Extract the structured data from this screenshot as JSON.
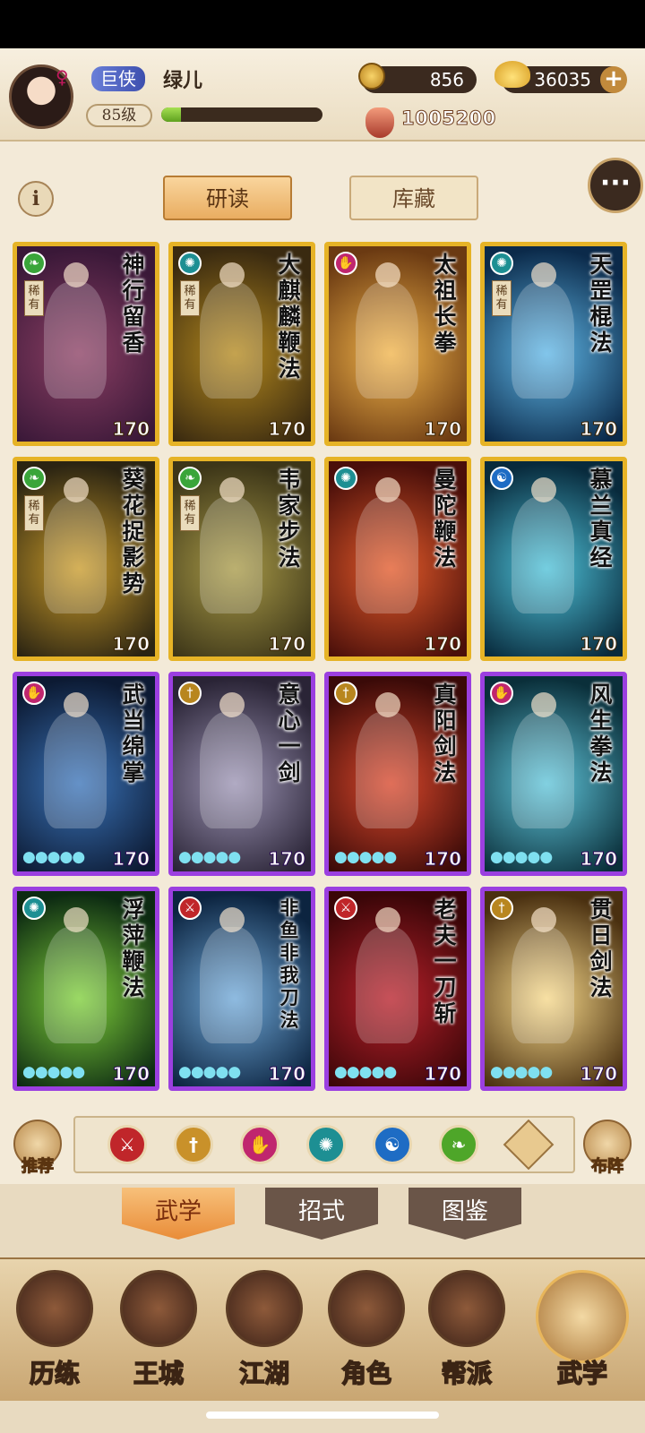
{
  "header": {
    "rank": "巨侠",
    "player_name": "绿儿",
    "level": "85级",
    "exp_fraction": 0.12,
    "coins": "856",
    "gold_ingots": "36035",
    "power": "1005200"
  },
  "tabs": {
    "study": "研读",
    "storage": "库藏"
  },
  "cards": [
    {
      "name": "神行留香",
      "value": "170",
      "rare_tag": "稀有",
      "frame": "gold",
      "sect": "green",
      "art": [
        "#3a1838",
        "#8b3f63"
      ]
    },
    {
      "name": "大麒麟鞭法",
      "value": "170",
      "rare_tag": "稀有",
      "frame": "gold",
      "sect": "teal",
      "art": [
        "#3a2a10",
        "#b4891e"
      ]
    },
    {
      "name": "太祖长拳",
      "value": "170",
      "rare_tag": "",
      "frame": "gold",
      "sect": "magenta",
      "art": [
        "#6b3a12",
        "#f1b44a"
      ]
    },
    {
      "name": "天罡棍法",
      "value": "170",
      "rare_tag": "稀有",
      "frame": "gold",
      "sect": "teal",
      "art": [
        "#0b2a4a",
        "#5fb6e6"
      ]
    },
    {
      "name": "葵花捉影势",
      "value": "170",
      "rare_tag": "稀有",
      "frame": "gold",
      "sect": "green",
      "art": [
        "#2b2412",
        "#c99b2a"
      ]
    },
    {
      "name": "韦家步法",
      "value": "170",
      "rare_tag": "稀有",
      "frame": "gold",
      "sect": "green",
      "art": [
        "#3d3618",
        "#a89a48"
      ]
    },
    {
      "name": "曼陀鞭法",
      "value": "170",
      "rare_tag": "",
      "frame": "gold",
      "sect": "teal",
      "art": [
        "#4a0f0a",
        "#e35a2a"
      ]
    },
    {
      "name": "慕兰真经",
      "value": "170",
      "rare_tag": "",
      "frame": "gold",
      "sect": "blue",
      "art": [
        "#082a3c",
        "#4ec1d8"
      ]
    },
    {
      "name": "武当绵掌",
      "value": "170",
      "rare_tag": "",
      "frame": "purple",
      "sect": "magenta",
      "art": [
        "#0c1a33",
        "#3a73b8"
      ]
    },
    {
      "name": "意心一剑",
      "value": "170",
      "rare_tag": "",
      "frame": "purple",
      "sect": "gold",
      "art": [
        "#2a2436",
        "#9b93b3"
      ]
    },
    {
      "name": "真阳剑法",
      "value": "170",
      "rare_tag": "",
      "frame": "purple",
      "sect": "gold",
      "art": [
        "#3a0a08",
        "#d8472b"
      ]
    },
    {
      "name": "风生拳法",
      "value": "170",
      "rare_tag": "",
      "frame": "purple",
      "sect": "magenta",
      "art": [
        "#0a2f3a",
        "#5fc4d9"
      ]
    },
    {
      "name": "浮萍鞭法",
      "value": "170",
      "rare_tag": "",
      "frame": "purple",
      "sect": "teal",
      "art": [
        "#0c2a12",
        "#7fcf3a"
      ]
    },
    {
      "name": "非鱼非我刀法",
      "value": "170",
      "rare_tag": "",
      "frame": "purple",
      "sect": "red",
      "art": [
        "#0c2440",
        "#6fa8d8"
      ]
    },
    {
      "name": "老夫一刀斩",
      "value": "170",
      "rare_tag": "",
      "frame": "purple",
      "sect": "red",
      "art": [
        "#3a0608",
        "#b8202a"
      ]
    },
    {
      "name": "贯日剑法",
      "value": "170",
      "rare_tag": "",
      "frame": "purple",
      "sect": "gold",
      "art": [
        "#4a3010",
        "#f6d88a"
      ]
    }
  ],
  "filter": {
    "recommend": "推荐",
    "formation": "布阵",
    "sects": [
      {
        "name": "sword-sect-icon",
        "color": "#c0262a"
      },
      {
        "name": "blade-sect-icon",
        "color": "#c9912a"
      },
      {
        "name": "fist-sect-icon",
        "color": "#c0266e"
      },
      {
        "name": "fan-sect-icon",
        "color": "#1d8f93"
      },
      {
        "name": "taiji-sect-icon",
        "color": "#1e6cc4"
      },
      {
        "name": "leg-sect-icon",
        "color": "#4ea629"
      }
    ]
  },
  "subtabs": [
    "武学",
    "招式",
    "图鉴"
  ],
  "nav": [
    "历练",
    "王城",
    "江湖",
    "角色",
    "帮派",
    "武学"
  ]
}
